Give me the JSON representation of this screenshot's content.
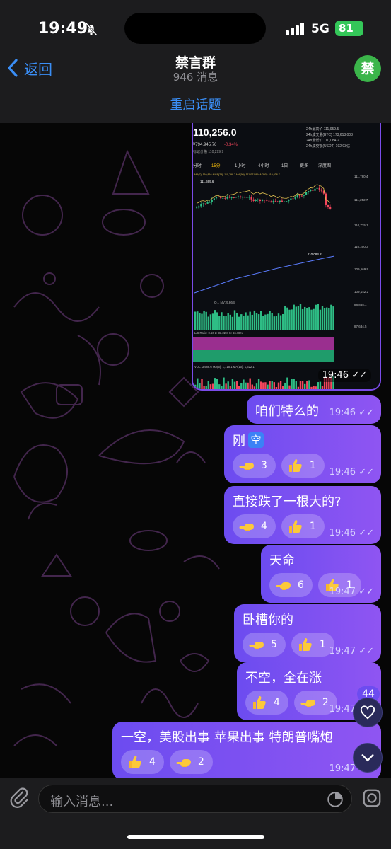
{
  "status_bar": {
    "time": "19:49",
    "network": "5G",
    "battery": "81"
  },
  "header": {
    "back_label": "返回",
    "title": "禁言群",
    "subtitle": "946 消息",
    "avatar_letter": "禁"
  },
  "topic_bar": {
    "label": "重启话题"
  },
  "image_message": {
    "time": "19:46",
    "price": "110,256.0",
    "sub_price": "¥794,945.76",
    "change": "-0.34%",
    "mark_price": "标记价格 110,299.9",
    "intervals": [
      "分时",
      "15分",
      "1小时",
      "4小时",
      "1日",
      "更多",
      "深度图"
    ],
    "ma_line": "MA(7): 110,816.4  MA(25): 110,799.7  MA(99): 111,021.9  MA(200): 110,036.7",
    "right_stats": [
      "24h最高价 111,959.5",
      "24h成交量(BTC) 173,613.008",
      "24h最低价 110,084.2",
      "24h成交额(USDT) 192.93亿"
    ],
    "price_ticks": [
      "111,780.4",
      "111,252.7",
      "110,725.1",
      "110,250.3",
      "109,669.9",
      "109,142.2",
      "88,865.1",
      "87,634.5"
    ],
    "peak_label": "111,699.6",
    "low_label": "110,084.2",
    "oi_label": "O.I. NV: 9.86B",
    "ratio_label": "L/S Ratio: 0.50   L: 33.22%   S: 66.78%",
    "volume_label": "VOL: 3.988.6   MA(5): 1,715.1   MA(10): 1,622.1"
  },
  "messages": [
    {
      "text": "咱们特么的",
      "time": "19:46",
      "reactions": []
    },
    {
      "text": "刚",
      "badge": "空",
      "time": "19:46",
      "reactions": [
        {
          "icon": "point-left-emoji",
          "count": "3"
        },
        {
          "icon": "thumbs-up-emoji",
          "count": "1"
        }
      ]
    },
    {
      "text": "直接跌了一根大的?",
      "time": "19:46",
      "reactions": [
        {
          "icon": "point-left-emoji",
          "count": "4"
        },
        {
          "icon": "thumbs-up-emoji",
          "count": "1"
        }
      ]
    },
    {
      "text": "天命",
      "time": "19:47",
      "reactions": [
        {
          "icon": "point-left-emoji",
          "count": "6"
        },
        {
          "icon": "thumbs-up-emoji",
          "count": "1"
        }
      ]
    },
    {
      "text": "卧槽你的",
      "time": "19:47",
      "reactions": [
        {
          "icon": "point-left-emoji",
          "count": "5"
        },
        {
          "icon": "thumbs-up-emoji",
          "count": "1"
        }
      ]
    },
    {
      "text": "不空，全在涨",
      "time": "19:47",
      "reactions": [
        {
          "icon": "thumbs-up-emoji",
          "count": "4"
        },
        {
          "icon": "point-left-emoji",
          "count": "2"
        }
      ]
    },
    {
      "text": "一空，美股出事 苹果出事  特朗普嘴炮",
      "time": "19:47",
      "reactions": [
        {
          "icon": "thumbs-up-emoji",
          "count": "4"
        },
        {
          "icon": "point-left-emoji",
          "count": "2"
        }
      ]
    }
  ],
  "floating": {
    "reactions_count": "44"
  },
  "input": {
    "placeholder": "输入消息..."
  },
  "colors": {
    "accent": "#3a8ef6",
    "bubble_start": "#6c4cf0",
    "bubble_end": "#8f55f2",
    "avatar": "#3bb54a"
  }
}
